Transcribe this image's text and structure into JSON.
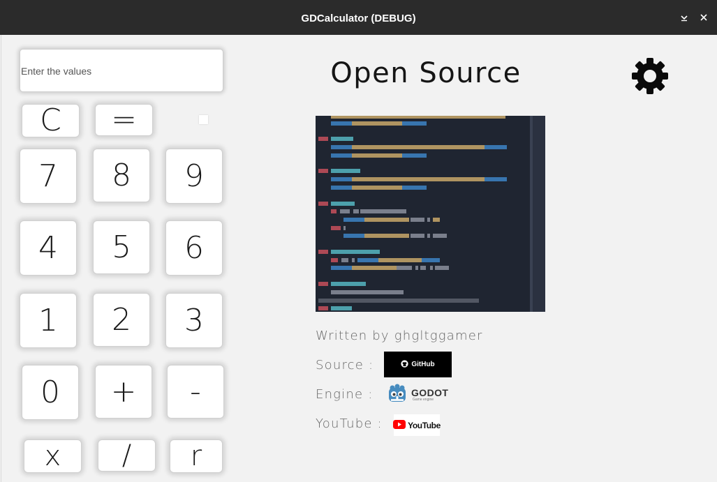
{
  "window": {
    "title": "GDCalculator (DEBUG)"
  },
  "input": {
    "placeholder": "Enter the values",
    "value": ""
  },
  "keys": {
    "clear": "C",
    "equals": "=",
    "seven": "7",
    "eight": "8",
    "nine": "9",
    "four": "4",
    "five": "5",
    "six": "6",
    "one": "1",
    "two": "2",
    "three": "3",
    "zero": "0",
    "plus": "+",
    "minus": "-",
    "multiply": "x",
    "divide": "/",
    "root": "r"
  },
  "about": {
    "heading": "Open Source",
    "author": "Written by ghgltggamer",
    "source_label": "Source :",
    "source_badge": "GitHub",
    "engine_label": "Engine :",
    "engine_badge": "GODOT",
    "engine_badge_sub": "Game engine",
    "youtube_label": "YouTube :",
    "youtube_badge": "YouTube"
  },
  "icons": {
    "minimize": "minimize-icon",
    "close": "close-icon",
    "settings": "gear-icon",
    "github": "github-icon",
    "godot": "godot-icon",
    "youtube": "youtube-icon"
  },
  "colors": {
    "titlebar": "#2b2b2b",
    "background": "#f2f2f2",
    "github_badge": "#000000",
    "youtube_red": "#ff0000",
    "godot_blue": "#478cbf",
    "code_bg": "#1e2430"
  }
}
